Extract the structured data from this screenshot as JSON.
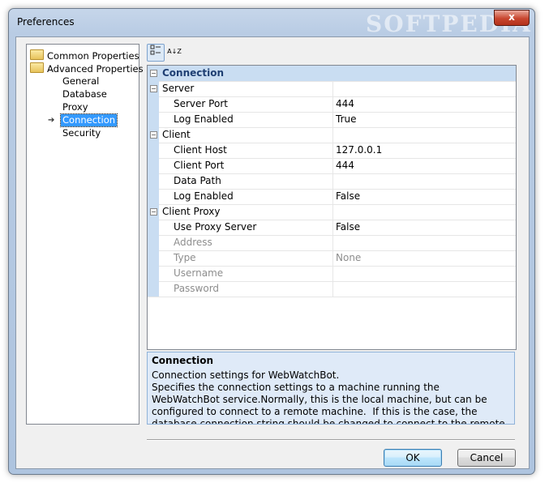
{
  "window": {
    "title": "Preferences",
    "watermark": "SOFTPEDIA",
    "close_label": "x"
  },
  "tree": {
    "items": [
      {
        "label": "Common Properties"
      },
      {
        "label": "Advanced Properties"
      },
      {
        "label": "General"
      },
      {
        "label": "Database"
      },
      {
        "label": "Proxy"
      },
      {
        "label": "Connection"
      },
      {
        "label": "Security"
      }
    ]
  },
  "toolbar": {
    "categorized_icon": "categorized-icon",
    "alphabetical_icon": "sort-az-icon",
    "alpha_label": "A↓Z"
  },
  "grid": {
    "header": "Connection",
    "rows": [
      {
        "name": "Server"
      },
      {
        "name": "Server Port",
        "value": "444"
      },
      {
        "name": "Log Enabled",
        "value": "True"
      },
      {
        "name": "Client"
      },
      {
        "name": "Client Host",
        "value": "127.0.0.1"
      },
      {
        "name": "Client Port",
        "value": "444"
      },
      {
        "name": "Data Path",
        "value": ""
      },
      {
        "name": "Log Enabled",
        "value": "False"
      },
      {
        "name": "Client Proxy"
      },
      {
        "name": "Use Proxy Server",
        "value": "False"
      },
      {
        "name": "Address",
        "value": ""
      },
      {
        "name": "Type",
        "value": "None"
      },
      {
        "name": "Username",
        "value": ""
      },
      {
        "name": "Password",
        "value": ""
      }
    ]
  },
  "description": {
    "title": "Connection",
    "text": "Connection settings for WebWatchBot.\nSpecifies the connection settings to a machine running the WebWatchBot service.Normally, this is the local machine, but can be configured to connect to a remote machine.  If this is the case, the database connection string should be changed to connect to the remote machine."
  },
  "buttons": {
    "ok": "OK",
    "cancel": "Cancel"
  }
}
